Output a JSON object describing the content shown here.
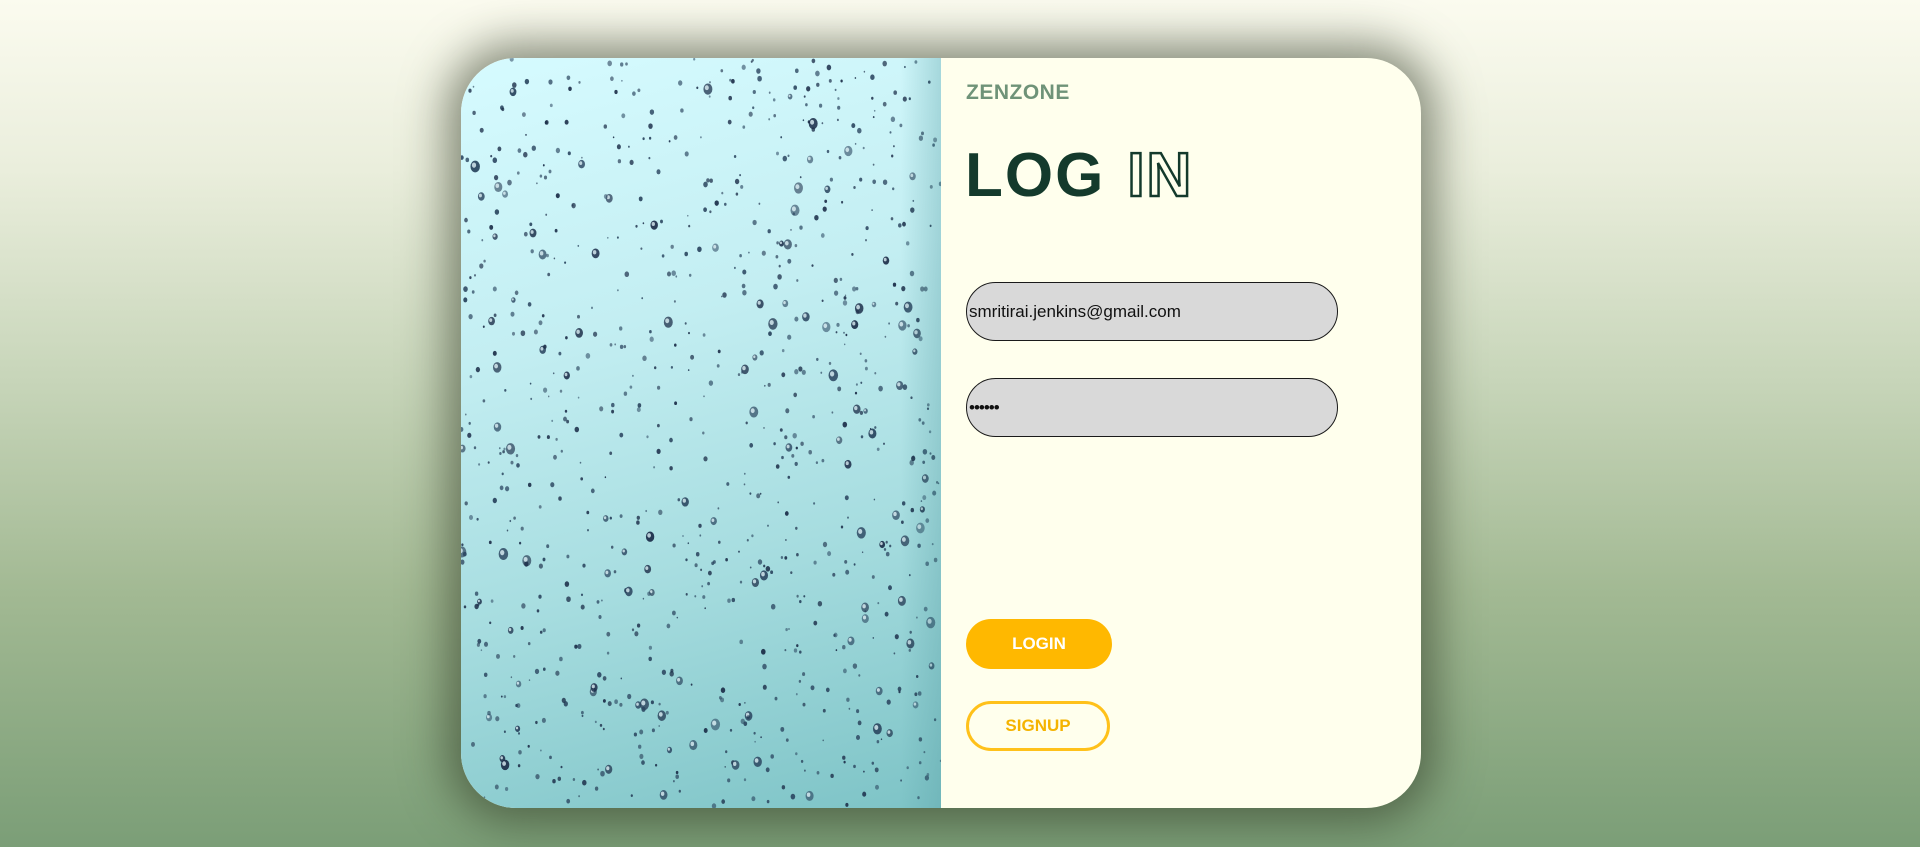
{
  "brand": {
    "name": "ZENZONE"
  },
  "heading": {
    "word1": "LOG",
    "word2": "IN"
  },
  "form": {
    "email_value": "smritirai.jenkins@gmail.com",
    "password_value": "••••••"
  },
  "buttons": {
    "login_label": "LOGIN",
    "signup_label": "SIGNUP"
  },
  "colors": {
    "accent": "#ffb800",
    "heading": "#143a2c",
    "brand": "#6f9378",
    "panel_bg": "#ffffed",
    "field_bg": "#d9d9d9"
  },
  "image": {
    "subject": "raindrops-on-glass"
  }
}
